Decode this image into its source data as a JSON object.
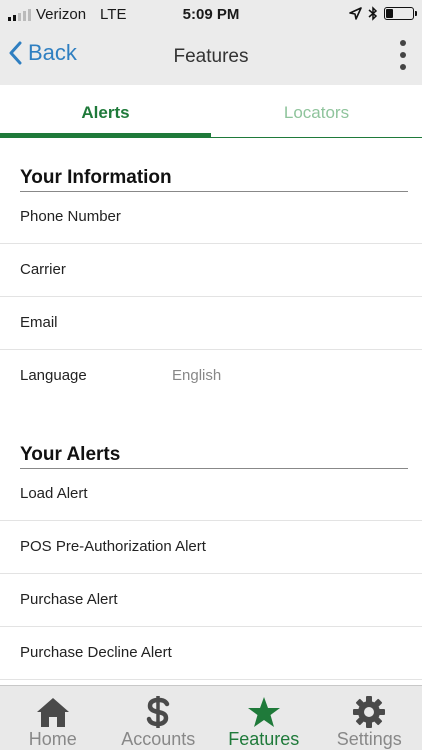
{
  "status_bar": {
    "carrier": "Verizon",
    "network": "LTE",
    "time": "5:09 PM",
    "battery_level": 0.25,
    "icons": [
      "signal-icon",
      "location-icon",
      "bluetooth-icon",
      "battery-icon"
    ]
  },
  "nav": {
    "back_label": "Back",
    "title": "Features",
    "accent_color": "#2f7fc1"
  },
  "tabs": [
    {
      "label": "Alerts",
      "active": true
    },
    {
      "label": "Locators",
      "active": false
    }
  ],
  "your_information": {
    "title": "Your Information",
    "rows": [
      {
        "label": "Phone Number",
        "value": ""
      },
      {
        "label": "Carrier",
        "value": ""
      },
      {
        "label": "Email",
        "value": ""
      },
      {
        "label": "Language",
        "value": "English"
      }
    ]
  },
  "your_alerts": {
    "title": "Your Alerts",
    "rows": [
      {
        "label": "Load Alert"
      },
      {
        "label": "POS Pre-Authorization Alert"
      },
      {
        "label": "Purchase Alert"
      },
      {
        "label": "Purchase Decline Alert"
      }
    ]
  },
  "tab_bar": {
    "active_color": "#1f7a3a",
    "items": [
      {
        "label": "Home",
        "icon": "home-icon",
        "active": false
      },
      {
        "label": "Accounts",
        "icon": "dollar-icon",
        "active": false
      },
      {
        "label": "Features",
        "icon": "star-icon",
        "active": true
      },
      {
        "label": "Settings",
        "icon": "gear-icon",
        "active": false
      }
    ]
  }
}
